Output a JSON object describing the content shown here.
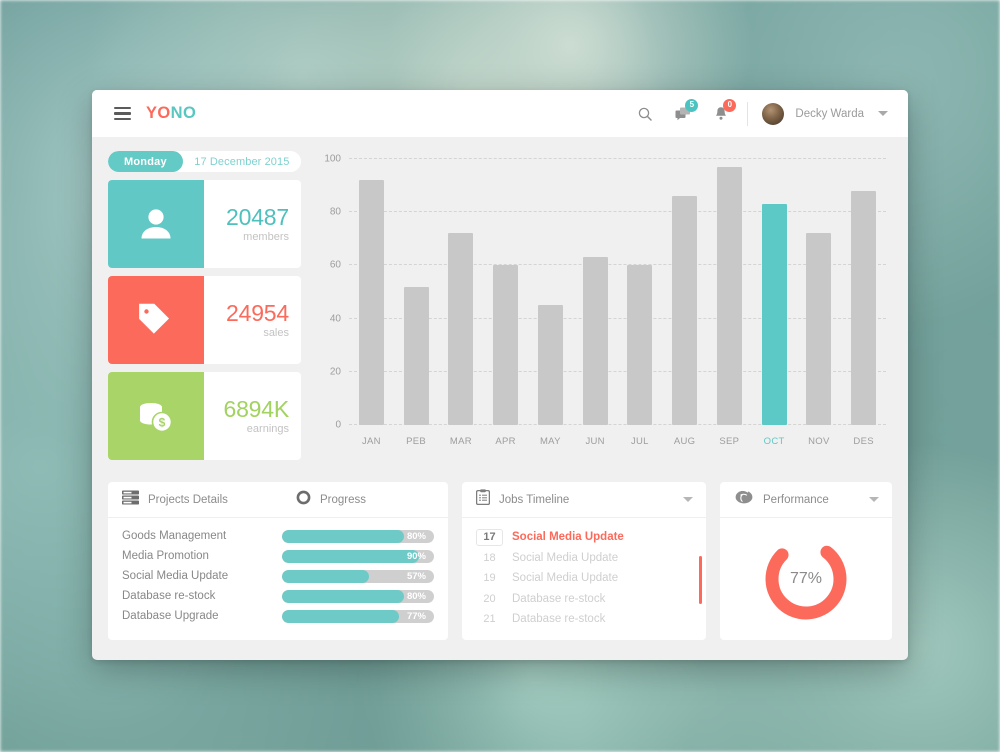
{
  "header": {
    "menu_icon": "hamburger-icon",
    "brand_first": "YO",
    "brand_second": "NO",
    "search_icon": "search-icon",
    "messages_icon": "message-icon",
    "messages_badge": "5",
    "notifications_icon": "bell-icon",
    "notifications_badge": "0",
    "user_name": "Decky Warda",
    "user_caret_icon": "chevron-down-icon",
    "avatar_icon": "avatar"
  },
  "datebar": {
    "day": "Monday",
    "date": "17 December 2015"
  },
  "stats": [
    {
      "icon": "user-icon",
      "value": "20487",
      "label": "members",
      "color": "#62c8c5"
    },
    {
      "icon": "tag-icon",
      "value": "24954",
      "label": "sales",
      "color": "#fb6a5b"
    },
    {
      "icon": "coins-icon",
      "value": "6894K",
      "label": "earnings",
      "color": "#a8d468"
    }
  ],
  "chart_data": {
    "type": "bar",
    "title": "",
    "xlabel": "",
    "ylabel": "",
    "categories": [
      "JAN",
      "PEB",
      "MAR",
      "APR",
      "MAY",
      "JUN",
      "JUL",
      "AUG",
      "SEP",
      "OCT",
      "NOV",
      "DES"
    ],
    "values": [
      92,
      52,
      72,
      60,
      45,
      63,
      60,
      86,
      97,
      83,
      72,
      88
    ],
    "highlight_index": 9,
    "highlight_color": "#5dc9c6",
    "bar_color": "#c8c8c8",
    "ylim": [
      0,
      100
    ],
    "yticks": [
      0,
      20,
      40,
      60,
      80,
      100
    ],
    "grid": true,
    "legend": "none"
  },
  "projects": {
    "title": "Projects Details",
    "title_icon": "server-list-icon",
    "progress_title": "Progress",
    "progress_icon": "circle-ring-icon",
    "rows": [
      {
        "name": "Goods Management",
        "percent": 80,
        "label": "80%"
      },
      {
        "name": "Media Promotion",
        "percent": 90,
        "label": "90%"
      },
      {
        "name": "Social Media Update",
        "percent": 57,
        "label": "57%"
      },
      {
        "name": "Database re-stock",
        "percent": 80,
        "label": "80%"
      },
      {
        "name": "Database Upgrade",
        "percent": 77,
        "label": "77%"
      }
    ]
  },
  "jobs": {
    "title": "Jobs Timeline",
    "title_icon": "clipboard-icon",
    "caret_icon": "chevron-down-icon",
    "rows": [
      {
        "date": "17",
        "name": "Social Media Update",
        "active": true
      },
      {
        "date": "18",
        "name": "Social Media Update",
        "active": false
      },
      {
        "date": "19",
        "name": "Social Media Update",
        "active": false
      },
      {
        "date": "20",
        "name": "Database re-stock",
        "active": false
      },
      {
        "date": "21",
        "name": "Database re-stock",
        "active": false
      }
    ]
  },
  "performance": {
    "title": "Performance",
    "title_icon": "performance-icon",
    "caret_icon": "chevron-down-icon",
    "percent": 77,
    "value_label": "77%",
    "ring_color": "#fb6a5b"
  }
}
